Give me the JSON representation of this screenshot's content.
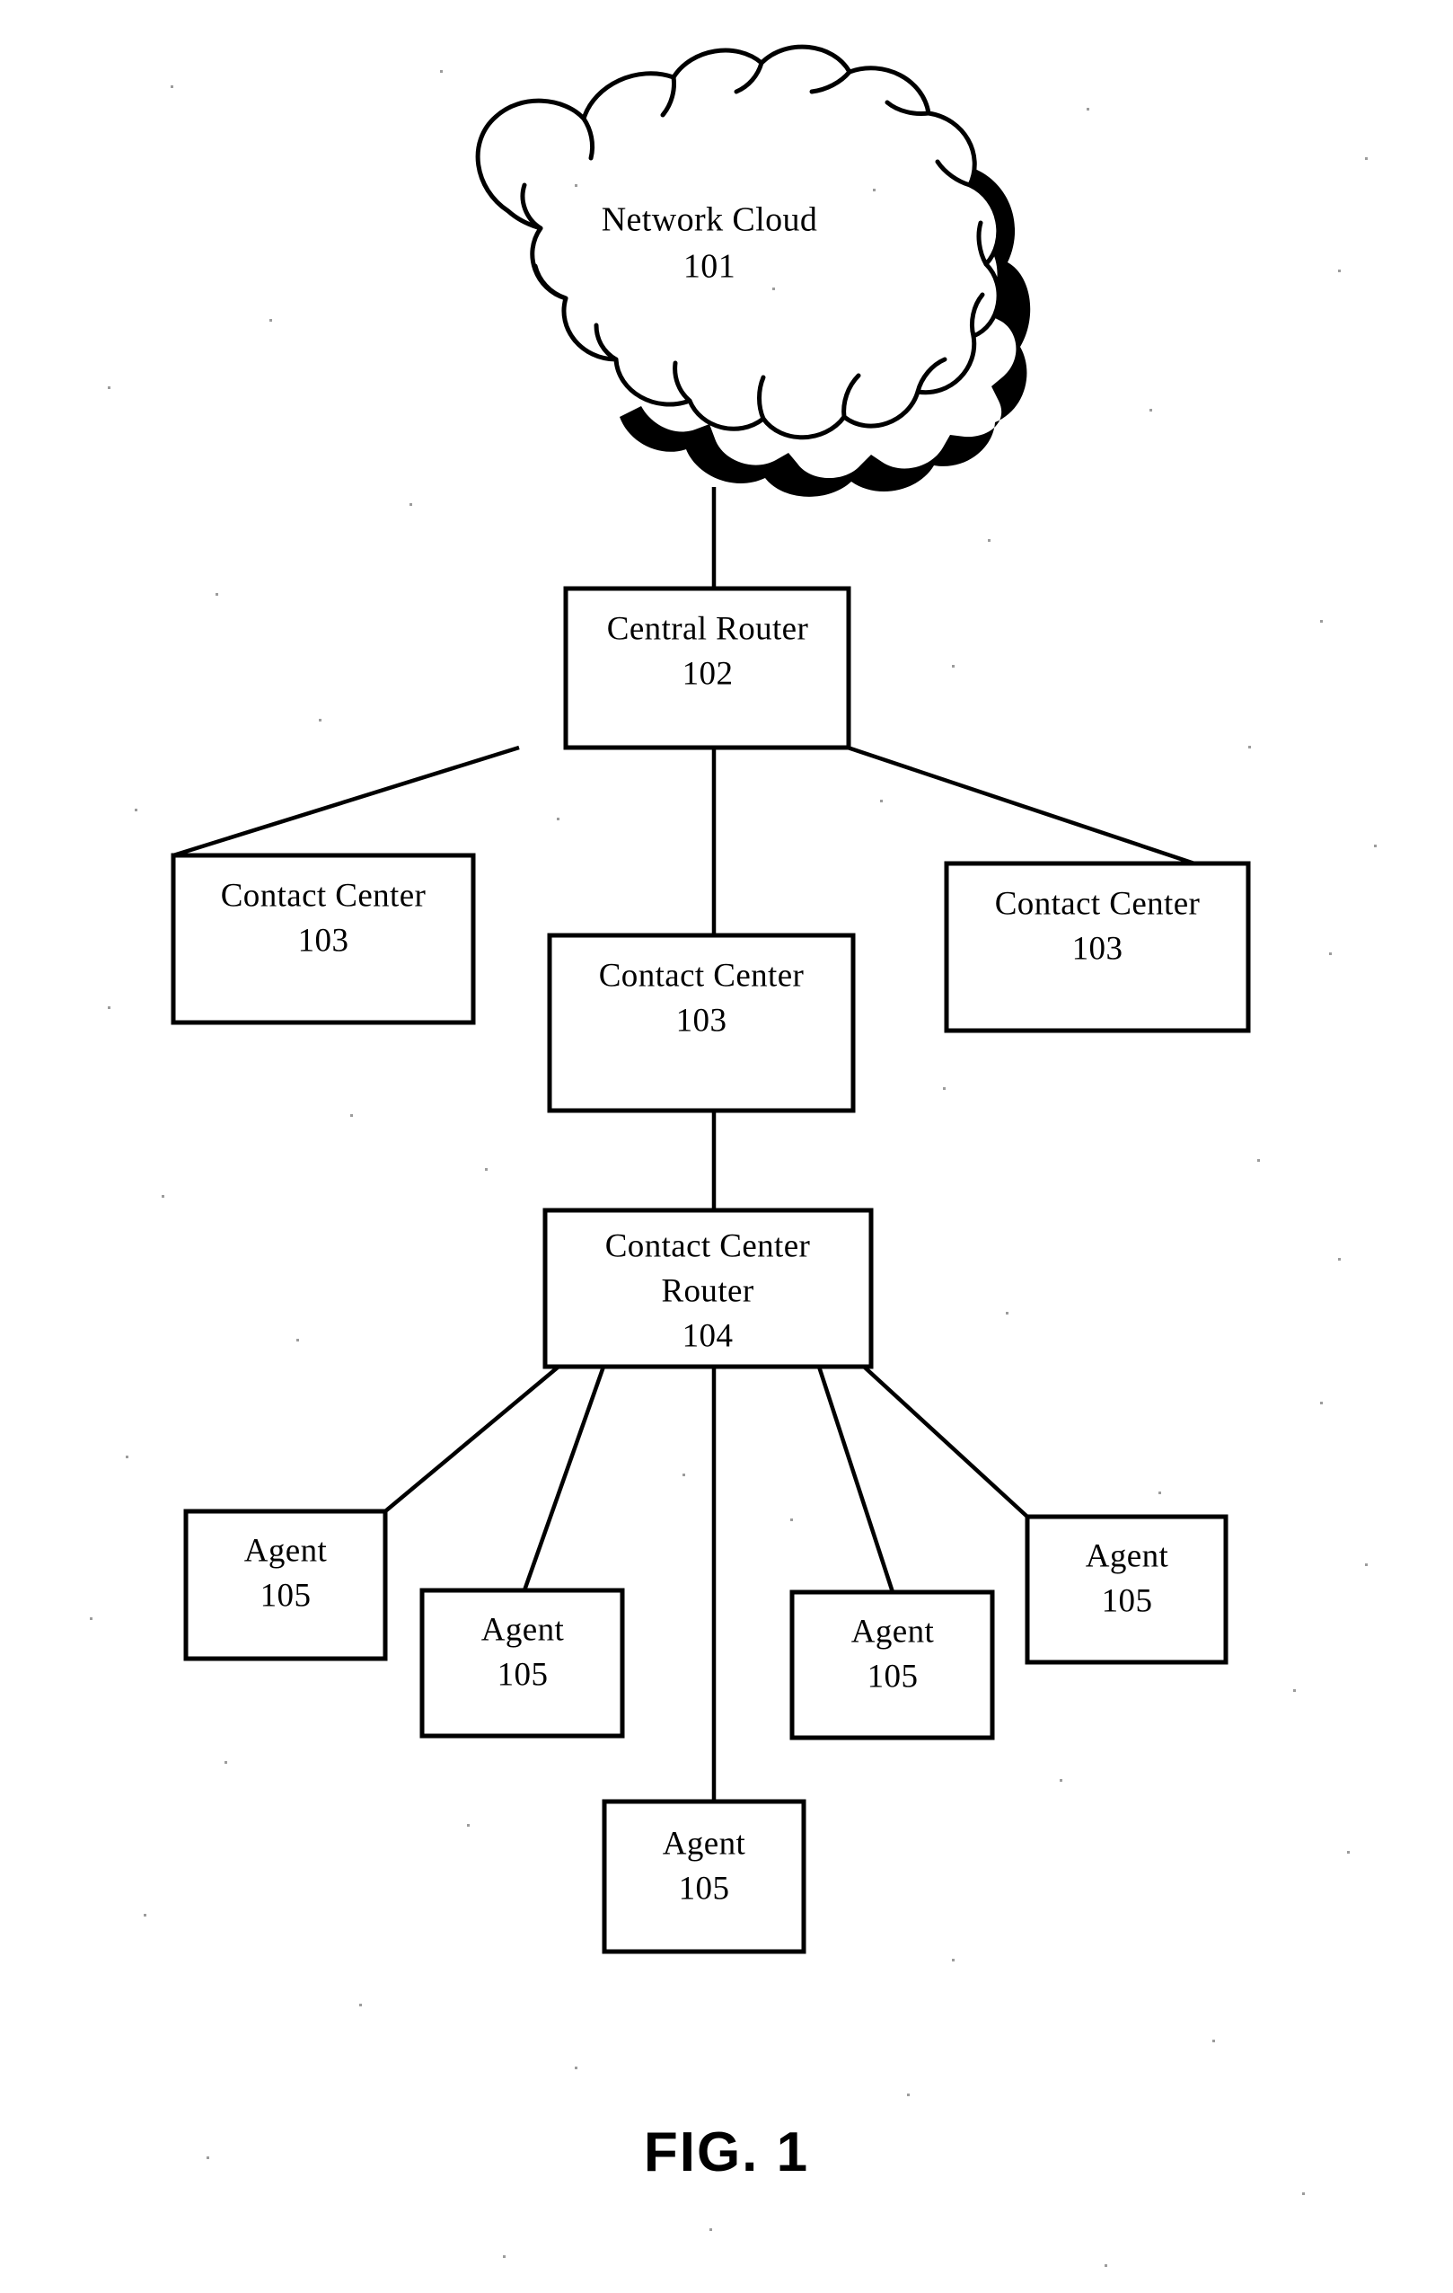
{
  "figure": {
    "caption": "FIG. 1",
    "background_color": "#ffffff",
    "ink_color": "#000000"
  },
  "nodes": {
    "network_cloud": {
      "title": "Network Cloud",
      "reference_numeral": "101",
      "shape": "cloud"
    },
    "central_router": {
      "title": "Central Router",
      "reference_numeral": "102",
      "shape": "rectangle"
    },
    "contact_center_left": {
      "title": "Contact Center",
      "reference_numeral": "103",
      "shape": "rectangle"
    },
    "contact_center_middle": {
      "title": "Contact Center",
      "reference_numeral": "103",
      "shape": "rectangle"
    },
    "contact_center_right": {
      "title": "Contact Center",
      "reference_numeral": "103",
      "shape": "rectangle"
    },
    "contact_center_router": {
      "title_line1": "Contact Center",
      "title_line2": "Router",
      "reference_numeral": "104",
      "shape": "rectangle"
    },
    "agent_1": {
      "title": "Agent",
      "reference_numeral": "105",
      "shape": "rectangle"
    },
    "agent_2": {
      "title": "Agent",
      "reference_numeral": "105",
      "shape": "rectangle"
    },
    "agent_3": {
      "title": "Agent",
      "reference_numeral": "105",
      "shape": "rectangle"
    },
    "agent_4": {
      "title": "Agent",
      "reference_numeral": "105",
      "shape": "rectangle"
    },
    "agent_5": {
      "title": "Agent",
      "reference_numeral": "105",
      "shape": "rectangle"
    }
  },
  "connections": [
    {
      "from": "network_cloud",
      "to": "central_router"
    },
    {
      "from": "central_router",
      "to": "contact_center_left"
    },
    {
      "from": "central_router",
      "to": "contact_center_middle"
    },
    {
      "from": "central_router",
      "to": "contact_center_right"
    },
    {
      "from": "contact_center_middle",
      "to": "contact_center_router"
    },
    {
      "from": "contact_center_router",
      "to": "agent_1"
    },
    {
      "from": "contact_center_router",
      "to": "agent_2"
    },
    {
      "from": "contact_center_router",
      "to": "agent_3"
    },
    {
      "from": "contact_center_router",
      "to": "agent_4"
    },
    {
      "from": "contact_center_router",
      "to": "agent_5"
    }
  ]
}
